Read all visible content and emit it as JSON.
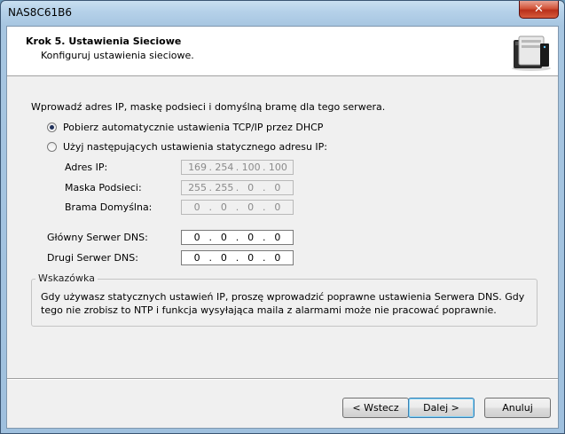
{
  "window": {
    "title": "NAS8C61B6",
    "close_label": "✕"
  },
  "header": {
    "step_title": "Krok 5. Ustawienia Sieciowe",
    "step_subtitle": "Konfiguruj ustawienia sieciowe.",
    "icon": "nas-device-icon"
  },
  "form": {
    "intro": "Wprowadź adres IP, maskę podsieci i domyślną bramę dla tego serwera.",
    "radio_dhcp": {
      "label": "Pobierz automatycznie ustawienia TCP/IP przez DHCP",
      "checked": true
    },
    "radio_static": {
      "label": "Użyj następujących ustawienia statycznego adresu IP:",
      "checked": false
    },
    "ip": {
      "label": "Adres IP:",
      "octets": [
        "169",
        "254",
        "100",
        "100"
      ],
      "enabled": false
    },
    "mask": {
      "label": "Maska Podsieci:",
      "octets": [
        "255",
        "255",
        "0",
        "0"
      ],
      "enabled": false
    },
    "gateway": {
      "label": "Brama Domyślna:",
      "octets": [
        "0",
        "0",
        "0",
        "0"
      ],
      "enabled": false
    },
    "dns1": {
      "label": "Główny Serwer DNS:",
      "octets": [
        "0",
        "0",
        "0",
        "0"
      ],
      "enabled": true
    },
    "dns2": {
      "label": "Drugi Serwer DNS:",
      "octets": [
        "0",
        "0",
        "0",
        "0"
      ],
      "enabled": true
    }
  },
  "hint": {
    "title": "Wskazówka",
    "text": "Gdy używasz statycznych ustawień IP, proszę wprowadzić poprawne ustawienia Serwera DNS. Gdy tego nie zrobisz to NTP i funkcja wysyłająca maila z alarmami może nie pracować poprawnie."
  },
  "buttons": {
    "back": "< Wstecz",
    "next": "Dalej >",
    "cancel": "Anuluj"
  }
}
